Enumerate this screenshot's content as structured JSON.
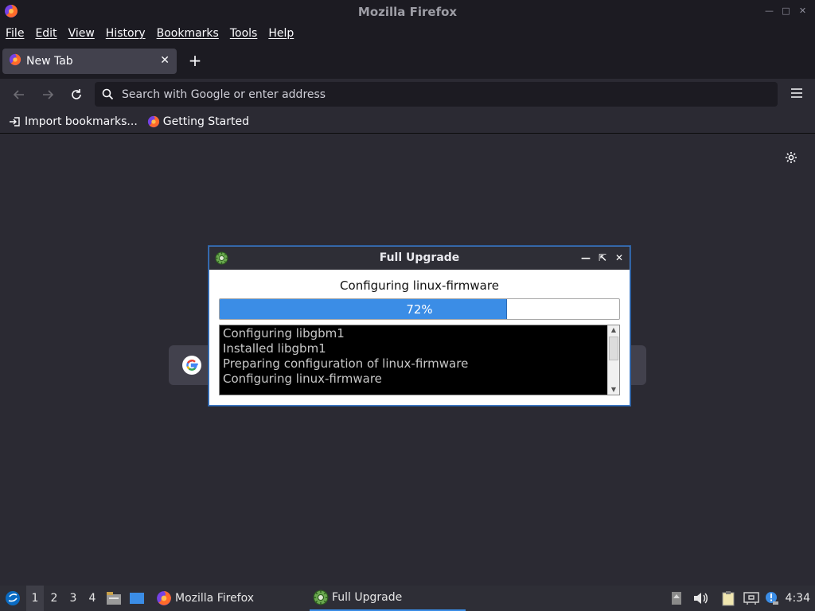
{
  "window": {
    "title": "Mozilla Firefox",
    "controls": [
      "minimize",
      "maximize",
      "close"
    ]
  },
  "menubar": {
    "items": [
      {
        "label": "File"
      },
      {
        "label": "Edit"
      },
      {
        "label": "View"
      },
      {
        "label": "History"
      },
      {
        "label": "Bookmarks"
      },
      {
        "label": "Tools"
      },
      {
        "label": "Help"
      }
    ]
  },
  "tabs": [
    {
      "label": "New Tab",
      "active": true
    }
  ],
  "navbar": {
    "search_placeholder": "Search with Google or enter address"
  },
  "bookmarks": [
    {
      "label": "Import bookmarks...",
      "icon": "import-icon"
    },
    {
      "label": "Getting Started",
      "icon": "firefox-icon"
    }
  ],
  "dialog": {
    "title": "Full Upgrade",
    "status": "Configuring linux-firmware",
    "progress_label": "72%",
    "progress_value": 0.72,
    "log_lines": [
      "Configuring libgbm1",
      "Installed libgbm1",
      "Preparing configuration of linux-firmware",
      "Configuring linux-firmware"
    ]
  },
  "taskbar": {
    "workspaces": [
      "1",
      "2",
      "3",
      "4"
    ],
    "active_workspace": "1",
    "tasks": [
      {
        "label": "Mozilla Firefox",
        "icon": "firefox-icon"
      },
      {
        "label": "Full Upgrade",
        "icon": "gear-icon",
        "active": true
      }
    ],
    "clock": "4:34"
  },
  "colors": {
    "accent": "#3b8de6",
    "chrome_bg": "#1c1b22",
    "content_bg": "#2b2a33"
  }
}
